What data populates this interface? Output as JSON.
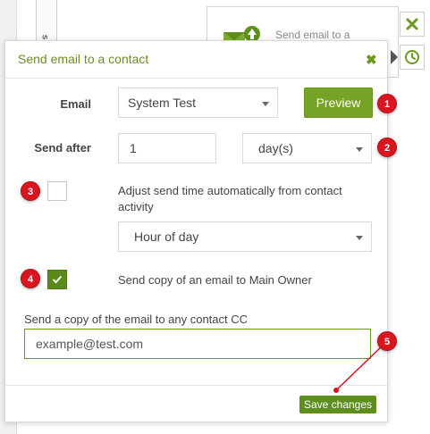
{
  "background": {
    "node_text": "Send email to a",
    "strip_text": "s"
  },
  "modal": {
    "title": "Send email to a contact",
    "close_symbol": "✖"
  },
  "form": {
    "email_label": "Email",
    "email_value": "System Test",
    "preview_label": "Preview",
    "send_after_label": "Send after",
    "send_after_value": "1",
    "unit_value": "day(s)",
    "adjust_text": "Adjust send time automatically from contact activity",
    "adjust_checked": false,
    "hour_value": "Hour of day",
    "copy_owner_text": "Send copy of an email to Main Owner",
    "copy_owner_checked": true,
    "cc_label": "Send a copy of the email to any contact CC",
    "cc_placeholder": "example@test.com",
    "save_label": "Save changes"
  },
  "annotations": {
    "badges": [
      "1",
      "2",
      "3",
      "4",
      "5"
    ],
    "color": "#d7161f"
  },
  "colors": {
    "accent": "#76a225",
    "accent_dark": "#5e8f1e"
  },
  "icons": [
    "close-icon",
    "clock-icon",
    "checkmark-icon",
    "email-upload-icon"
  ]
}
